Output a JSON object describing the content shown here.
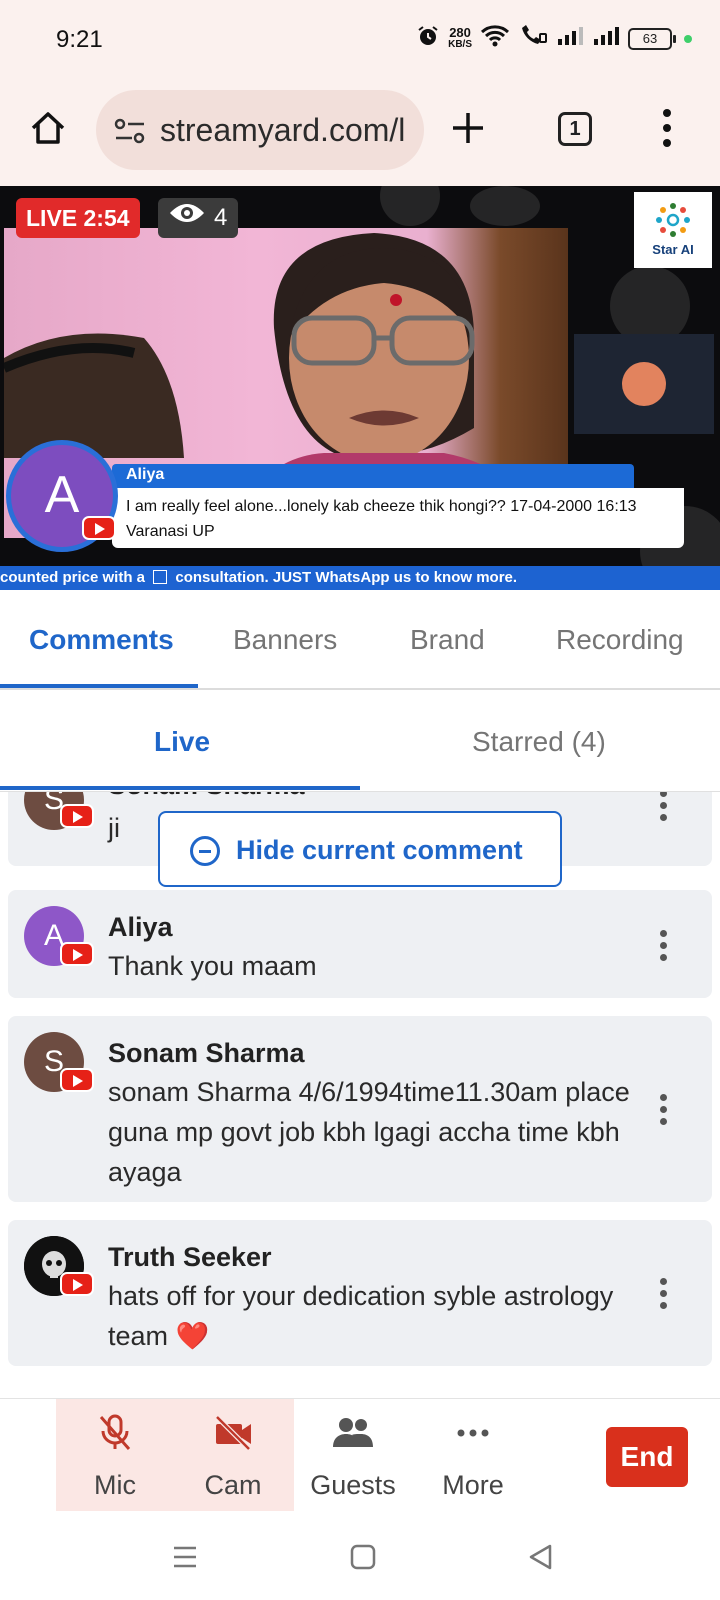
{
  "status_bar": {
    "time": "9:21",
    "speed_value": "280",
    "speed_unit": "KB/S",
    "battery": "63"
  },
  "browser": {
    "url": "streamyard.com/l",
    "tab_count": "1"
  },
  "stream": {
    "live_label": "LIVE 2:54",
    "viewer_count": "4",
    "brand_logo_text": "Star AI",
    "overlay_avatar_letter": "A",
    "overlay_name": "Aliya",
    "overlay_comment": "I am really feel alone...lonely kab cheeze thik hongi?? 17-04-2000 16:13 Varanasi UP",
    "ticker_prefix": "counted price with a",
    "ticker_suffix": "consultation. JUST WhatsApp us to know more."
  },
  "tabs": [
    {
      "label": "Comments",
      "active": true
    },
    {
      "label": "Banners",
      "active": false
    },
    {
      "label": "Brand",
      "active": false
    },
    {
      "label": "Recording",
      "active": false
    }
  ],
  "subtabs": [
    {
      "label": "Live",
      "active": true
    },
    {
      "label": "Starred (4)",
      "active": false
    }
  ],
  "hide_comment_button": "Hide current comment",
  "comments": [
    {
      "avatar": "S",
      "avatar_color": "#6d4c41",
      "name": "Sonam Sharma",
      "text": "ji"
    },
    {
      "avatar": "A",
      "avatar_color": "#8e57c8",
      "name": "Aliya",
      "text": "Thank you maam"
    },
    {
      "avatar": "S",
      "avatar_color": "#6d4c41",
      "name": "Sonam Sharma",
      "text": "sonam Sharma 4/6/1994time11.30am place guna mp govt job kbh lgagi accha time kbh ayaga"
    },
    {
      "avatar": "",
      "avatar_color": "#111111",
      "name": "Truth Seeker",
      "text": "hats off for your dedication syble astrology team ❤️"
    }
  ],
  "controls": {
    "mic": "Mic",
    "cam": "Cam",
    "guests": "Guests",
    "more": "More",
    "end": "End"
  },
  "colors": {
    "accent": "#1f66c9",
    "live_red": "#e12a2a",
    "end_red": "#d9301c",
    "youtube_red": "#e62117"
  }
}
